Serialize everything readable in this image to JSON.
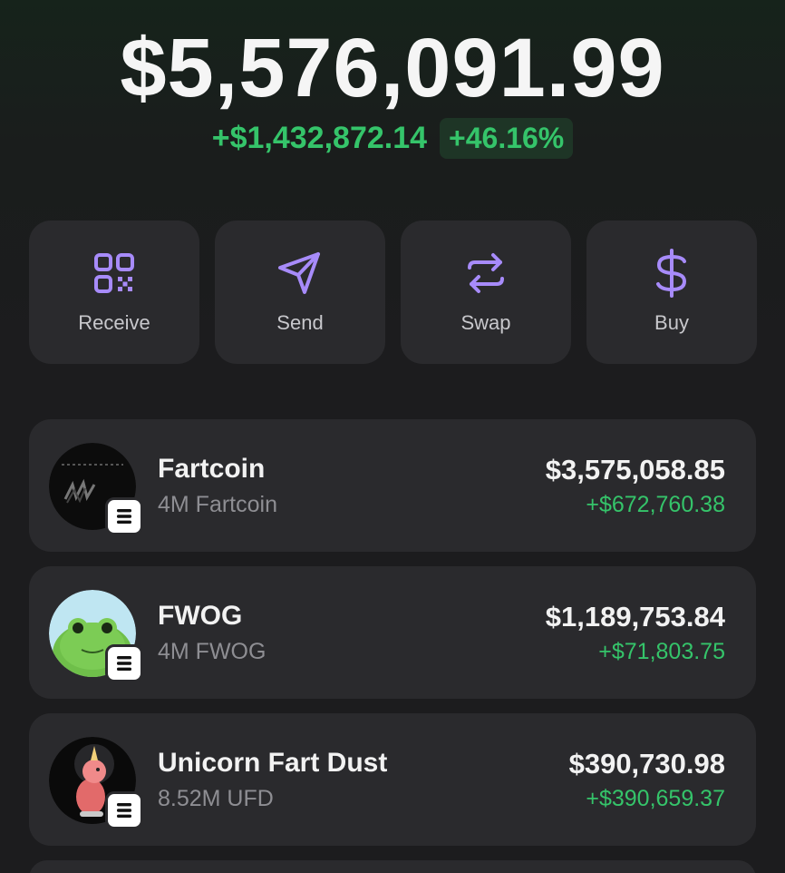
{
  "balance": {
    "total": "$5,576,091.99",
    "change_amount": "+$1,432,872.14",
    "change_percent": "+46.16%"
  },
  "colors": {
    "positive": "#35c46a",
    "accent_icon": "#a78bfa",
    "card_bg": "#2a2a2d"
  },
  "actions": [
    {
      "label": "Receive",
      "icon": "qr-code-icon"
    },
    {
      "label": "Send",
      "icon": "paper-plane-icon"
    },
    {
      "label": "Swap",
      "icon": "swap-arrows-icon"
    },
    {
      "label": "Buy",
      "icon": "dollar-icon"
    }
  ],
  "tokens": [
    {
      "name": "Fartcoin",
      "amount": "4M Fartcoin",
      "value": "$3,575,058.85",
      "change": "+$672,760.38",
      "avatar_icon": "fartcoin-logo-icon",
      "chain_icon": "solana-badge-icon"
    },
    {
      "name": "FWOG",
      "amount": "4M FWOG",
      "value": "$1,189,753.84",
      "change": "+$71,803.75",
      "avatar_icon": "frog-logo-icon",
      "chain_icon": "solana-badge-icon"
    },
    {
      "name": "Unicorn Fart Dust",
      "amount": "8.52M UFD",
      "value": "$390,730.98",
      "change": "+$390,659.37",
      "avatar_icon": "unicorn-logo-icon",
      "chain_icon": "solana-badge-icon"
    }
  ]
}
